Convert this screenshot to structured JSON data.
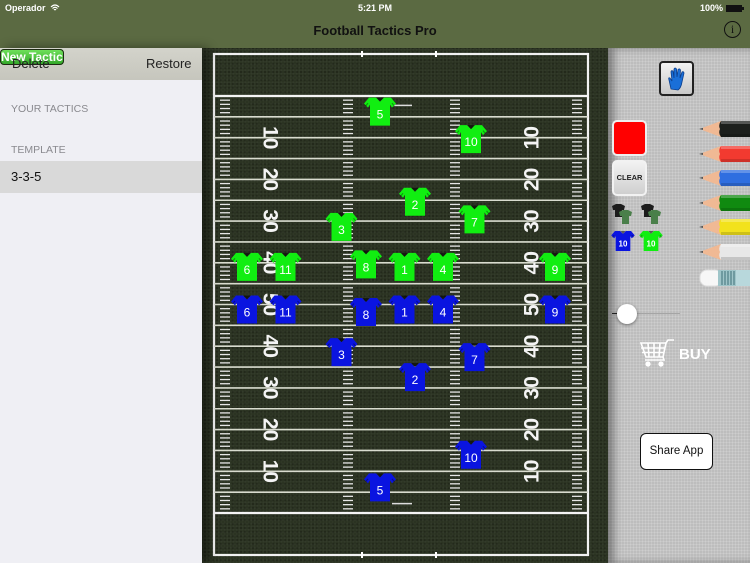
{
  "status_bar": {
    "carrier": "Operador",
    "time": "5:21 PM",
    "battery": "100%"
  },
  "nav": {
    "title": "Football Tactics Pro",
    "info_icon": "info-icon"
  },
  "sidebar": {
    "toolbar": {
      "delete_label": "Delete",
      "new_tactic_label": "New Tactic",
      "restore_label": "Restore"
    },
    "sections": [
      {
        "header": "YOUR TACTICS",
        "items": []
      },
      {
        "header": "TEMPLATE",
        "items": [
          {
            "label": "3-3-5",
            "selected": true
          }
        ]
      }
    ]
  },
  "field": {
    "yard_numbers_left": [
      "10",
      "20",
      "30",
      "40",
      "50",
      "40",
      "30",
      "20",
      "10"
    ],
    "yard_numbers_right": [
      "10",
      "20",
      "30",
      "40",
      "50",
      "40",
      "30",
      "20",
      "10"
    ],
    "team_colors": {
      "green": "#11ee11",
      "blue": "#0a14e0"
    },
    "players": [
      {
        "team": "green",
        "number": "5",
        "col": 0.44,
        "row": 0.115
      },
      {
        "team": "green",
        "number": "10",
        "col": 0.7,
        "row": 0.17
      },
      {
        "team": "green",
        "number": "2",
        "col": 0.54,
        "row": 0.295
      },
      {
        "team": "green",
        "number": "3",
        "col": 0.33,
        "row": 0.345
      },
      {
        "team": "green",
        "number": "7",
        "col": 0.71,
        "row": 0.33
      },
      {
        "team": "green",
        "number": "6",
        "col": 0.06,
        "row": 0.425
      },
      {
        "team": "green",
        "number": "11",
        "col": 0.17,
        "row": 0.425
      },
      {
        "team": "green",
        "number": "8",
        "col": 0.4,
        "row": 0.42
      },
      {
        "team": "green",
        "number": "1",
        "col": 0.51,
        "row": 0.425
      },
      {
        "team": "green",
        "number": "4",
        "col": 0.62,
        "row": 0.425
      },
      {
        "team": "green",
        "number": "9",
        "col": 0.94,
        "row": 0.425
      },
      {
        "team": "blue",
        "number": "6",
        "col": 0.06,
        "row": 0.51
      },
      {
        "team": "blue",
        "number": "11",
        "col": 0.17,
        "row": 0.51
      },
      {
        "team": "blue",
        "number": "8",
        "col": 0.4,
        "row": 0.515
      },
      {
        "team": "blue",
        "number": "1",
        "col": 0.51,
        "row": 0.51
      },
      {
        "team": "blue",
        "number": "4",
        "col": 0.62,
        "row": 0.51
      },
      {
        "team": "blue",
        "number": "9",
        "col": 0.94,
        "row": 0.51
      },
      {
        "team": "blue",
        "number": "3",
        "col": 0.33,
        "row": 0.595
      },
      {
        "team": "blue",
        "number": "7",
        "col": 0.71,
        "row": 0.605
      },
      {
        "team": "blue",
        "number": "2",
        "col": 0.54,
        "row": 0.645
      },
      {
        "team": "blue",
        "number": "10",
        "col": 0.7,
        "row": 0.8
      },
      {
        "team": "blue",
        "number": "5",
        "col": 0.44,
        "row": 0.865
      }
    ]
  },
  "tools": {
    "hand_icon": "hand-icon",
    "selected_color": "#ff0000",
    "clear_label": "CLEAR",
    "jersey_tools": [
      {
        "style": "shirt-black-green",
        "number": ""
      },
      {
        "style": "shirt-black-green",
        "number": ""
      },
      {
        "style": "blue-jersey",
        "number": "10",
        "color": "#0a14e0"
      },
      {
        "style": "green-jersey",
        "number": "10",
        "color": "#11ee11"
      }
    ],
    "pencils": [
      {
        "name": "black",
        "color": "#1c1f1c"
      },
      {
        "name": "red",
        "color": "#f23a30"
      },
      {
        "name": "blue",
        "color": "#2f6ee0"
      },
      {
        "name": "green",
        "color": "#108a10"
      },
      {
        "name": "yellow",
        "color": "#f2e21c"
      },
      {
        "name": "white",
        "color": "#e8e8e8"
      }
    ],
    "eraser_icon": "eraser-icon",
    "line_width_value": 0.05,
    "buy_label": "BUY",
    "share_label": "Share App"
  }
}
